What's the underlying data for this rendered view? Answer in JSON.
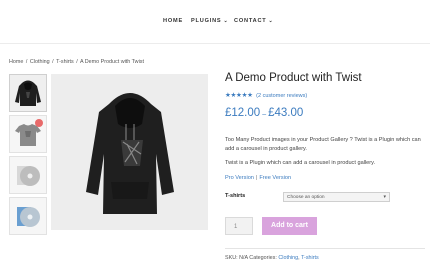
{
  "nav": {
    "items": [
      {
        "label": "HOME",
        "dropdown": false
      },
      {
        "label": "PLUGINS",
        "dropdown": true
      },
      {
        "label": "CONTACT",
        "dropdown": true
      }
    ]
  },
  "breadcrumb": {
    "items": [
      "Home",
      "Clothing",
      "T-shirts",
      "A Demo Product with Twist"
    ],
    "separator": "/"
  },
  "gallery": {
    "thumbnails": [
      "hoodie-black",
      "tshirt-grey-sale",
      "disc-white",
      "disc-blue"
    ],
    "main_image": "hoodie-black"
  },
  "product": {
    "title": "A Demo Product with Twist",
    "stars": "★★★★★",
    "rating_text": "(2 customer reviews)",
    "price_low": "£12.00",
    "price_sep": "–",
    "price_high": "£43.00",
    "description_1": "Too Many Product images in your Product Gallery ? Twist is a Plugin which can add a carousel in product gallery.",
    "description_2": "Twist is a Plugin which can add a carousel in product gallery.",
    "link_pro": "Pro Version",
    "link_bar": "|",
    "link_free": "Free Version",
    "variant_label": "T-shirts",
    "variant_placeholder": "Choose an option",
    "quantity": "1",
    "add_to_cart": "Add to cart",
    "sku_label": "SKU:",
    "sku_value": "N/A",
    "categories_label": "Categories:",
    "categories": [
      "Clothing",
      "T-shirts"
    ],
    "categories_sep": ","
  },
  "colors": {
    "accent": "#3b7bbf",
    "button": "#d9a3dd"
  }
}
